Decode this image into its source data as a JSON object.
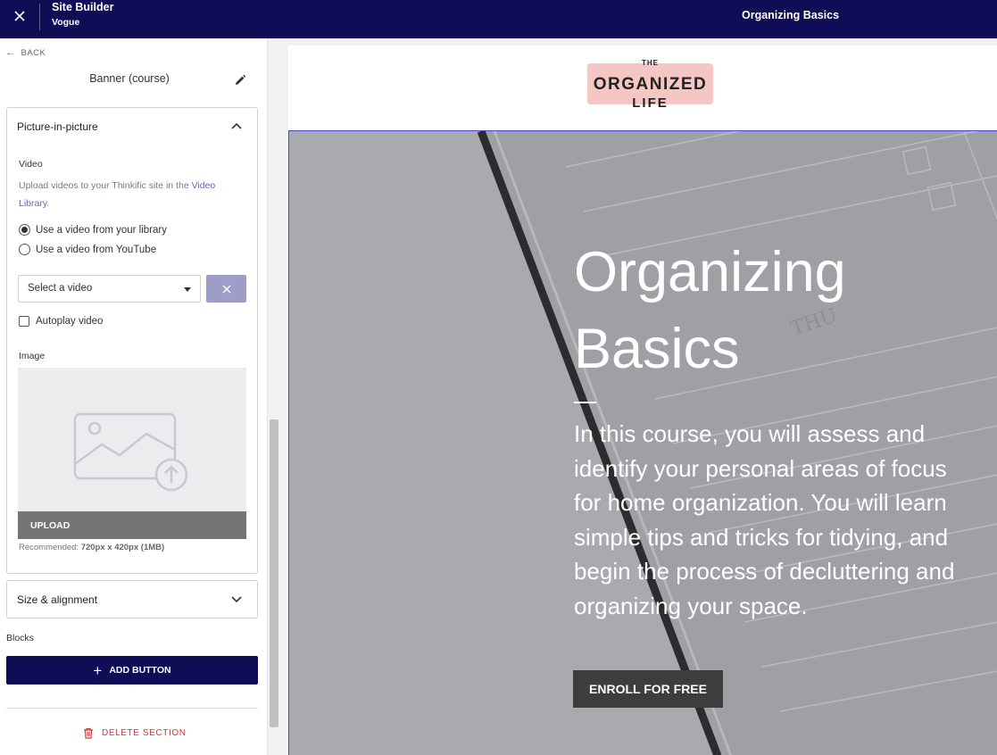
{
  "topbar": {
    "app_title": "Site Builder",
    "theme_name": "Vogue",
    "page_title": "Organizing Basics",
    "color": "#0f0d55"
  },
  "sidebar": {
    "back_label": "BACK",
    "section_name": "Banner (course)",
    "pip_panel": {
      "title": "Picture-in-picture",
      "video_label": "Video",
      "help_text": "Upload videos to your Thinkific site in the ",
      "help_link": "Video Library",
      "help_end": ".",
      "radio_library": "Use a video from your library",
      "radio_youtube": "Use a video from YouTube",
      "selected_radio": "library",
      "select_placeholder": "Select a video",
      "autoplay_label": "Autoplay video",
      "autoplay_checked": false,
      "image_label": "Image",
      "upload_label": "UPLOAD",
      "recommend_prefix": "Recommended: ",
      "recommend_value": "720px x 420px (1MB)"
    },
    "size_panel": {
      "title": "Size & alignment"
    },
    "blocks_label": "Blocks",
    "add_button_label": "ADD BUTTON",
    "delete_label": "DELETE SECTION"
  },
  "preview": {
    "logo": {
      "the": "THE",
      "organized": "ORGANIZED",
      "life": "LIFE",
      "bg_color": "#f4c6c4"
    },
    "hero": {
      "title_line1": "Organizing",
      "title_line2": "Basics",
      "description": "In this course, you will assess and identify your personal areas of focus for home organization. You will learn simple tips and tricks for tidying, and begin the process of decluttering and organizing your space.",
      "background_text": "THU",
      "cta_label": "ENROLL FOR FREE"
    }
  }
}
